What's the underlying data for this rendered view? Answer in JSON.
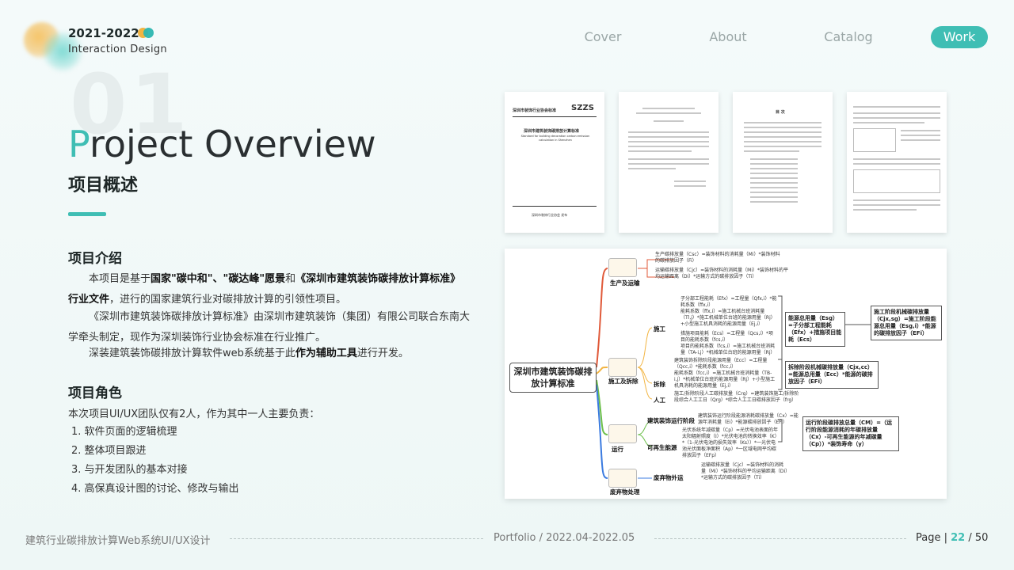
{
  "header": {
    "year": "2021-2022",
    "subtitle": "Interaction Design",
    "brand_colors": [
      "#f2b441",
      "#2cb6b0"
    ]
  },
  "nav": {
    "items": [
      "Cover",
      "About",
      "Catalog",
      "Work"
    ],
    "active": "Work",
    "accent": "#3fbeb4"
  },
  "section": {
    "number": "01",
    "title_first": "P",
    "title_rest": "roject Overview",
    "subtitle": "项目概述"
  },
  "intro": {
    "heading": "项目介绍",
    "p1_a": "本项目是基于",
    "p1_b": "国家\"碳中和\"、\"碳达峰\"愿景",
    "p1_c": "和",
    "p1_d": "《深圳市建筑装饰碳排放计算标准》行业文件",
    "p1_e": "，进行的国家建筑行业对碳排放计算的引领性项目。",
    "p2": "《深圳市建筑装饰碳排放计算标准》由深圳市建筑装饰（集团）有限公司联合东南大学牵头制定，现作为深圳装饰行业协会标准在行业推广。",
    "p3_a": "深装建筑装饰碳排放计算软件web系统基于此",
    "p3_b": "作为辅助工具",
    "p3_c": "进行开发。"
  },
  "role": {
    "heading": "项目角色",
    "intro": "本次项目UI/UX团队仅有2人，作为其中一人主要负责：",
    "items": [
      "1. 软件页面的逻辑梳理",
      "2. 整体项目跟进",
      "3. 与开发团队的基本对接",
      "4. 高保真设计图的讨论、修改与输出"
    ]
  },
  "documents": {
    "doc1_org": "深圳市装饰行业协会标准",
    "doc1_code": "SZZS",
    "doc1_title": "深圳市建筑装饰碳排放计算标准",
    "doc1_en": "Standard for building decoration carbon emission calculation in Shenzhen",
    "doc1_footer": "深圳市装饰行业协会  发布",
    "doc3_title": "目  次"
  },
  "mindmap": {
    "root": "深圳市建筑装饰碳排放计算标准",
    "branches": {
      "production": "生产及运输",
      "construction": "施工及拆除",
      "operation": "运行",
      "waste": "废弃物处理"
    },
    "sub": {
      "build": "施工",
      "demolish": "拆除",
      "labor": "人工",
      "op_stage": "建筑装饰运行阶段",
      "renewable": "可再生能源",
      "waste_out": "废弃物外运"
    },
    "prod_lines": [
      "生产碳排放量（Csc）=装饰材料的消耗量（Mi）*装饰材料的碳排放因子（Fi）",
      "运输碳排放量（Cjc）=装饰材料的消耗量（Mi）*装饰材料的平均运输距离（Di）*运输方式的碳排放因子（Ti）"
    ],
    "build_lines": [
      "子分部工程能耗（Efx）=工程量（Qfx,i）*能耗系数（ffx,i）",
      "能耗系数（ffx,i）=施工机械台班消耗量（Tl,j）*施工机械单位台班的能源用量（Rj）+小型施工机具消耗的能源用量（Ej,i）",
      "措施项目能耗（Ecs）=工程量（Qcs,i）*项目的能耗系数（fcs,i）",
      "项目的能耗系数（fcs,i）=施工机械台班消耗量（TA-i,j）*机械单位台班的能源用量（Rj）"
    ],
    "demolish_lines": [
      "建筑装饰拆除阶段能源用量（Ecc）=工程量（Qcc,i）*能耗系数（fcc,i）",
      "能耗系数（fcc,i）=施工机械台班消耗量（TB-i,j）*机械单位台班的能源用量（Rj）+小型施工机具消耗的能源用量（Ej,i）"
    ],
    "labor_line": "施工/拆除阶段人工碳排放量（Crg）=建筑装饰施工/拆除阶段综合人工工日（Qrg）*综合人工工日碳排放因子（frg）",
    "op_line": "建筑装饰运行阶段能源消耗碳排放量（Cx）=能源年消耗量（Ei）*能源碳排放因子（EFi）",
    "renew_line": "光伏系统年减碳量（Cp）=光伏电池表面的年太阳辐射照度（I）*光伏电池的转换效率（K）*（1-光伏电池的损失效率（Ks））*一光伏电池光伏面板净面积（Ap）*一区域电网平均碳排放因子（EFp）",
    "waste_line": "运输碳排放量（Cjc）=装饰材料的消耗量（Mi）*装饰材料的平均运输距离（Di）*运输方式的碳排放因子（Ti）",
    "box_energy": "能源总用量（Esg）=子分部工程能耗（Efx）+措施项目能耗（Ecs）",
    "box_build_res": "施工阶段机械碳排放量（Cjx,sg）=施工阶段能源总用量（Esg,i）*能源的碳排放因子（EFi）",
    "box_demolish_res": "拆除阶段机械碳排放量（Cjx,cc）=能源总用量（Ecc）*能源的碳排放因子（EFi）",
    "box_op_res": "运行阶段碳排放总量（CM）=（运行阶段能源消耗的年碳排放量（Cx）-可再生能源的年减碳量（Cp））*装饰寿命（y）",
    "branch_colors": [
      "#e05a3a",
      "#f2b441",
      "#6cbf4a",
      "#3b7be0"
    ]
  },
  "footer": {
    "left": "建筑行业碳排放计算Web系统UI/UX设计",
    "mid": "Portfolio / 2022.04-2022.05",
    "page_label": "Page",
    "page_current": "22",
    "page_total": "/ 50"
  }
}
